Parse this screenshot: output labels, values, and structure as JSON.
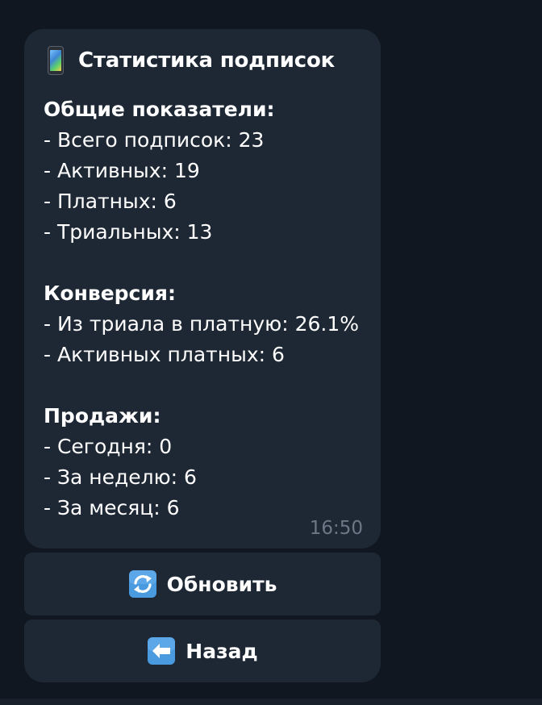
{
  "message": {
    "title": "Статистика подписок",
    "title_icon": "mobile-phone-icon",
    "general": {
      "heading": "Общие показатели:",
      "lines": [
        "- Всего подписок: 23",
        "- Активных: 19",
        "- Платных: 6",
        "- Триальных: 13"
      ]
    },
    "conversion": {
      "heading": "Конверсия:",
      "lines": [
        "- Из триала в платную: 26.1%",
        "- Активных платных: 6"
      ]
    },
    "sales": {
      "heading": "Продажи:",
      "lines": [
        "- Сегодня: 0",
        "- За неделю: 6",
        "- За месяц: 6"
      ]
    },
    "time": "16:50"
  },
  "buttons": {
    "refresh": {
      "label": "Обновить",
      "icon": "refresh-arrows-icon"
    },
    "back": {
      "label": "Назад",
      "icon": "left-arrow-icon"
    }
  },
  "colors": {
    "background": "#101720",
    "bubble": "#1e2835",
    "text": "#ffffff",
    "time": "#6c7885",
    "emoji_blue": "#4a9ae0"
  }
}
